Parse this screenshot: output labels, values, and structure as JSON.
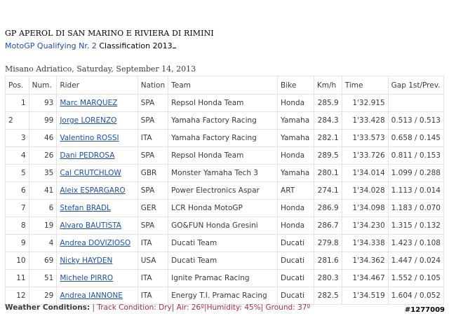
{
  "header": {
    "title": "GP APEROL DI SAN MARINO E RIVIERA DI RIMINI",
    "session_highlight": "MotoGP Qualifying Nr. 2",
    "session_rest": " Classification 2013",
    "location_date": "Misano Adriatico, Saturday, September 14, 2013"
  },
  "table": {
    "columns": [
      "Pos.",
      "Num.",
      "Rider",
      "Nation",
      "Team",
      "Bike",
      "Km/h",
      "Time",
      "Gap 1st/Prev."
    ],
    "rows": [
      {
        "pos": "1",
        "num": "93",
        "rider": "Marc MARQUEZ",
        "nation": "SPA",
        "team": "Repsol Honda Team",
        "bike": "Honda",
        "kmh": "285.9",
        "time": "1'32.915",
        "gap": ""
      },
      {
        "pos": "2",
        "num": "99",
        "rider": "Jorge LORENZO",
        "nation": "SPA",
        "team": "Yamaha Factory Racing",
        "bike": "Yamaha",
        "kmh": "284.3",
        "time": "1'33.428",
        "gap": "0.513 / 0.513"
      },
      {
        "pos": "3",
        "num": "46",
        "rider": "Valentino ROSSI",
        "nation": "ITA",
        "team": "Yamaha Factory Racing",
        "bike": "Yamaha",
        "kmh": "282.1",
        "time": "1'33.573",
        "gap": "0.658 / 0.145"
      },
      {
        "pos": "4",
        "num": "26",
        "rider": "Dani PEDROSA",
        "nation": "SPA",
        "team": "Repsol Honda Team",
        "bike": "Honda",
        "kmh": "289.5",
        "time": "1'33.726",
        "gap": "0.811 / 0.153"
      },
      {
        "pos": "5",
        "num": "35",
        "rider": "Cal CRUTCHLOW",
        "nation": "GBR",
        "team": "Monster Yamaha Tech 3",
        "bike": "Yamaha",
        "kmh": "280.1",
        "time": "1'34.014",
        "gap": "1.099 / 0.288"
      },
      {
        "pos": "6",
        "num": "41",
        "rider": "Aleix ESPARGARO",
        "nation": "SPA",
        "team": "Power Electronics Aspar",
        "bike": "ART",
        "kmh": "274.1",
        "time": "1'34.028",
        "gap": "1.113 / 0.014"
      },
      {
        "pos": "7",
        "num": "6",
        "rider": "Stefan BRADL",
        "nation": "GER",
        "team": "LCR Honda MotoGP",
        "bike": "Honda",
        "kmh": "286.9",
        "time": "1'34.098",
        "gap": "1.183 / 0.070"
      },
      {
        "pos": "8",
        "num": "19",
        "rider": "Alvaro BAUTISTA",
        "nation": "SPA",
        "team": "GO&FUN Honda Gresini",
        "bike": "Honda",
        "kmh": "286.7",
        "time": "1'34.230",
        "gap": "1.315 / 0.132"
      },
      {
        "pos": "9",
        "num": "4",
        "rider": "Andrea DOVIZIOSO",
        "nation": "ITA",
        "team": "Ducati Team",
        "bike": "Ducati",
        "kmh": "279.8",
        "time": "1'34.338",
        "gap": "1.423 / 0.108"
      },
      {
        "pos": "10",
        "num": "69",
        "rider": "Nicky HAYDEN",
        "nation": "USA",
        "team": "Ducati Team",
        "bike": "Ducati",
        "kmh": "281.6",
        "time": "1'34.362",
        "gap": "1.447 / 0.024"
      },
      {
        "pos": "11",
        "num": "51",
        "rider": "Michele PIRRO",
        "nation": "ITA",
        "team": "Ignite Pramac Racing",
        "bike": "Ducati",
        "kmh": "280.3",
        "time": "1'34.467",
        "gap": "1.552 / 0.105"
      },
      {
        "pos": "12",
        "num": "29",
        "rider": "Andrea IANNONE",
        "nation": "ITA",
        "team": "Energy T.I. Pramac Racing",
        "bike": "Ducati",
        "kmh": "282.5",
        "time": "1'34.519",
        "gap": "1.604 / 0.052"
      }
    ]
  },
  "weather": {
    "label": "Weather Conditions:",
    "details": " |   Track Condition: Dry|  Air: 26º|Humidity: 45%|  Ground: 37º"
  },
  "watermark": "#1277009",
  "colors": {
    "link": "#1f4fa3",
    "weather_text": "#a0304a",
    "grid_line": "#e3e3e3"
  }
}
